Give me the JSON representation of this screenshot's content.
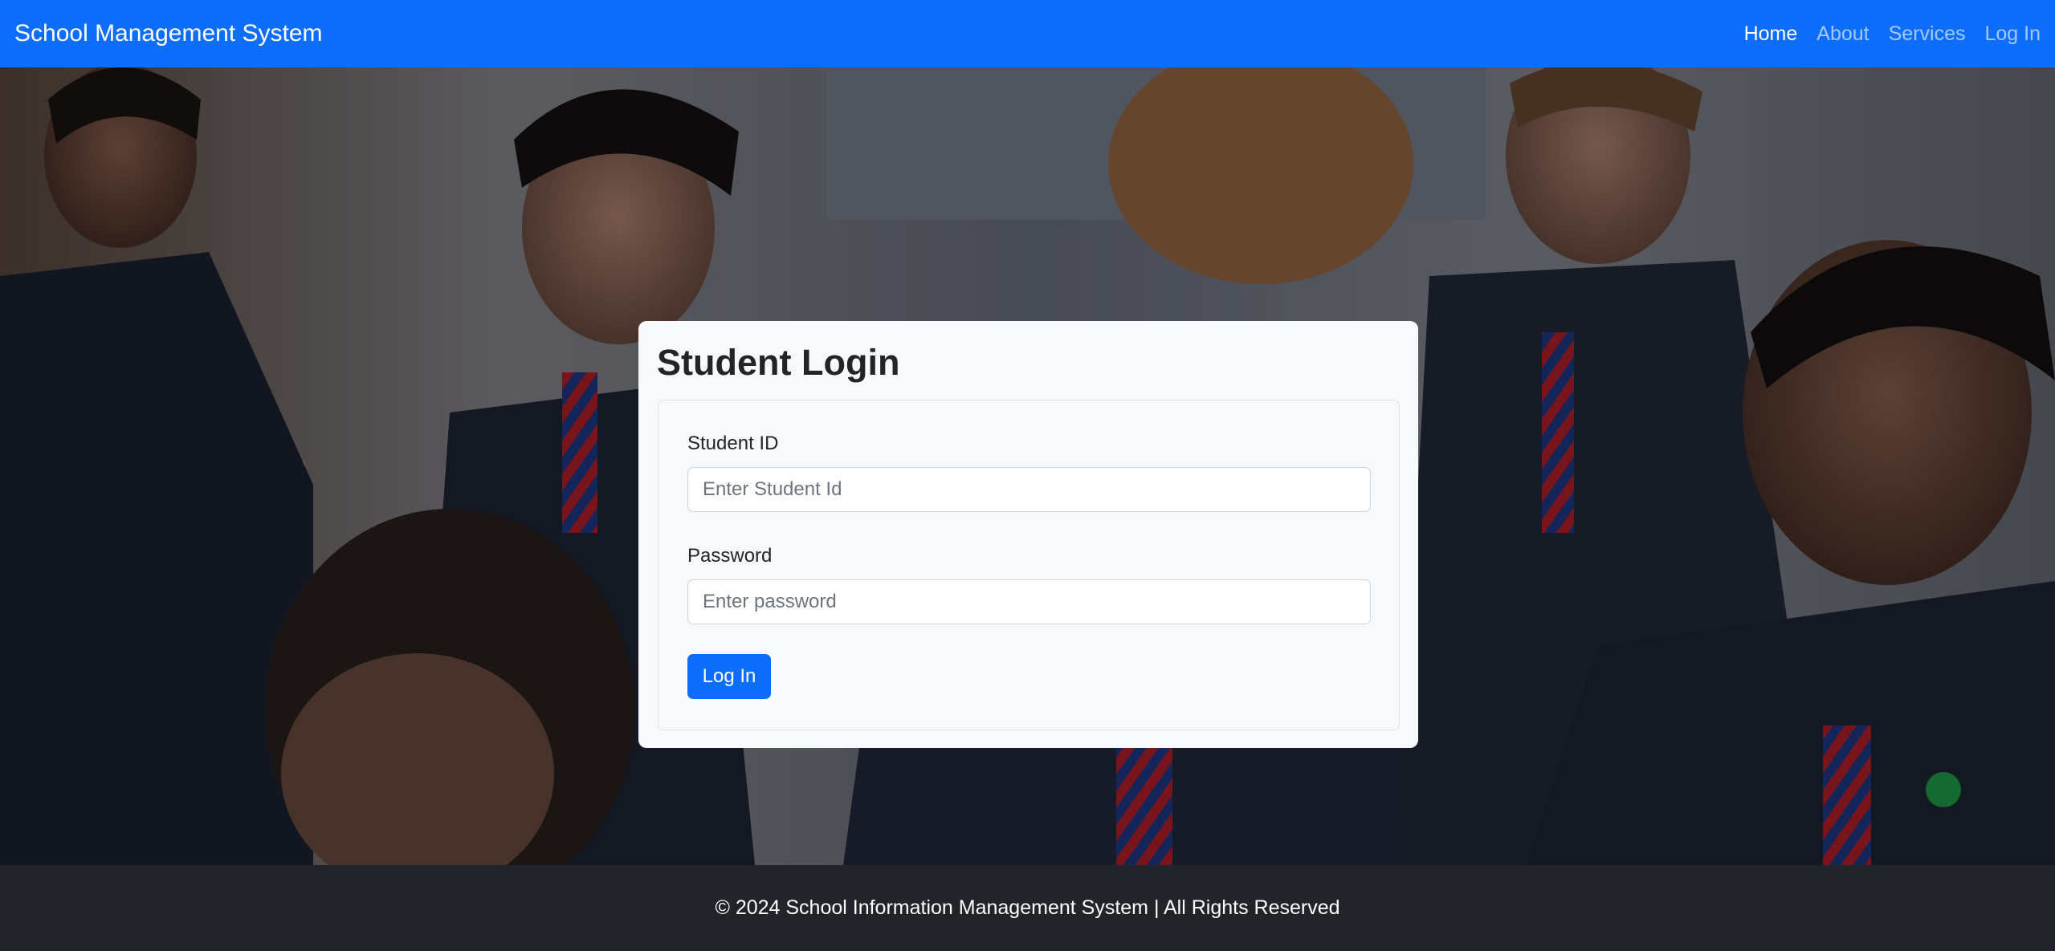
{
  "navbar": {
    "brand": "School Management System",
    "links": [
      {
        "label": "Home",
        "active": true
      },
      {
        "label": "About",
        "active": false
      },
      {
        "label": "Services",
        "active": false
      },
      {
        "label": "Log In",
        "active": false
      }
    ]
  },
  "login": {
    "title": "Student Login",
    "student_id_label": "Student ID",
    "student_id_placeholder": "Enter Student Id",
    "student_id_value": "",
    "password_label": "Password",
    "password_placeholder": "Enter password",
    "password_value": "",
    "submit_label": "Log In"
  },
  "footer": {
    "text": "© 2024 School Information Management System | All Rights Reserved"
  },
  "colors": {
    "primary": "#0d6efd",
    "footer_bg": "#212529",
    "card_bg": "#f8f9fa"
  }
}
